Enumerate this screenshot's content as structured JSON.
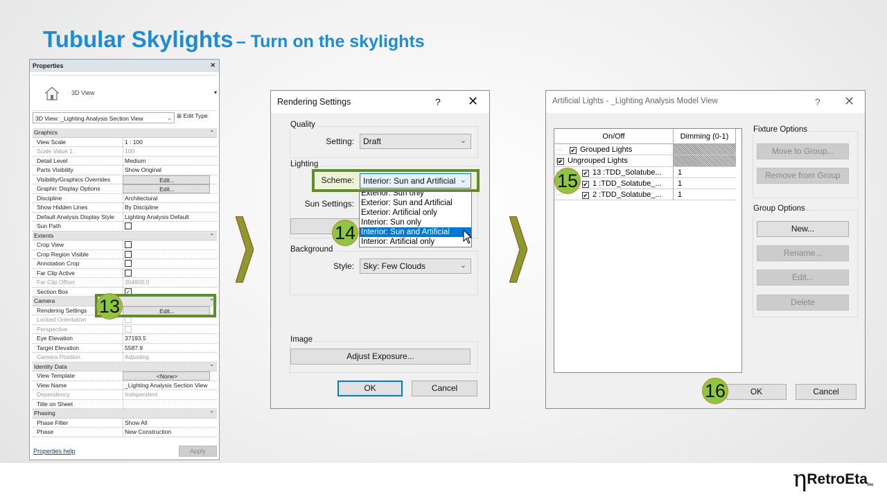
{
  "slide": {
    "title_main": "Tubular Skylights",
    "title_sub": "– Turn on the skylights",
    "logo_text": "RetroEta",
    "logo_suffix": "Inc",
    "accent": "#1e8bd3",
    "highlight_color": "#5e8d2e",
    "badge_color": "#8dc63f"
  },
  "badges": [
    "13",
    "14",
    "15",
    "16"
  ],
  "properties": {
    "title": "Properties",
    "type_label": "3D View",
    "view_selector": "3D View: _Lighting Analysis Section View",
    "edit_type": "Edit Type",
    "help_link": "Properties help",
    "apply": "Apply",
    "rows": [
      {
        "section": "Graphics"
      },
      {
        "k": "View Scale",
        "v": "1 : 100"
      },
      {
        "k": "Scale Value    1:",
        "v": "100",
        "dis": true
      },
      {
        "k": "Detail Level",
        "v": "Medium"
      },
      {
        "k": "Parts Visibility",
        "v": "Show Original"
      },
      {
        "k": "Visibility/Graphics Overrides",
        "v": "Edit...",
        "btn": true
      },
      {
        "k": "Graphic Display Options",
        "v": "Edit...",
        "btn": true
      },
      {
        "k": "Discipline",
        "v": "Architectural"
      },
      {
        "k": "Show Hidden Lines",
        "v": "By Discipline"
      },
      {
        "k": "Default Analysis Display Style",
        "v": "Lighting Analysis Default"
      },
      {
        "k": "Sun Path",
        "cb": false
      },
      {
        "section": "Extents"
      },
      {
        "k": "Crop View",
        "cb": false
      },
      {
        "k": "Crop Region Visible",
        "cb": false
      },
      {
        "k": "Annotation Crop",
        "cb": false
      },
      {
        "k": "Far Clip Active",
        "cb": false
      },
      {
        "k": "Far Clip Offset",
        "v": "304800.0",
        "dis": true
      },
      {
        "k": "Section Box",
        "cb": true
      },
      {
        "section": "Camera"
      },
      {
        "k": "Rendering Settings",
        "v": "Edit...",
        "btn": true
      },
      {
        "k": "Locked Orientation",
        "cb": false,
        "dis": true
      },
      {
        "k": "Perspective",
        "cb": false,
        "dis": true
      },
      {
        "k": "Eye Elevation",
        "v": "37193.5"
      },
      {
        "k": "Target Elevation",
        "v": "5587.9"
      },
      {
        "k": "Camera Position",
        "v": "Adjusting",
        "dis": true
      },
      {
        "section": "Identity Data"
      },
      {
        "k": "View Template",
        "v": "<None>",
        "btn": true
      },
      {
        "k": "View Name",
        "v": "_Lighting Analysis Section View"
      },
      {
        "k": "Dependency",
        "v": "Independent",
        "dis": true
      },
      {
        "k": "Title on Sheet",
        "v": ""
      },
      {
        "section": "Phasing"
      },
      {
        "k": "Phase Filter",
        "v": "Show All"
      },
      {
        "k": "Phase",
        "v": "New Construction"
      }
    ]
  },
  "rendering": {
    "title": "Rendering Settings",
    "help": "?",
    "close": "✕",
    "quality": {
      "label": "Quality",
      "setting_label": "Setting:",
      "setting_value": "Draft"
    },
    "lighting": {
      "label": "Lighting",
      "scheme_label": "Scheme:",
      "scheme_value": "Interior: Sun and Artificial",
      "sun_label": "Sun Settings:",
      "options": [
        "Exterior: Sun only",
        "Exterior: Sun and Artificial",
        "Exterior: Artificial only",
        "Interior: Sun only",
        "Interior: Sun and Artificial",
        "Interior: Artificial only"
      ],
      "selected_index": 4
    },
    "background": {
      "label": "Background",
      "style_label": "Style:",
      "style_value": "Sky: Few Clouds"
    },
    "image": {
      "label": "Image",
      "adjust": "Adjust Exposure..."
    },
    "ok": "OK",
    "cancel": "Cancel"
  },
  "artificial": {
    "title": "Artificial Lights - _Lighting Analysis Model View",
    "help": "?",
    "close": "✕",
    "columns": [
      "On/Off",
      "Dimming (0-1)"
    ],
    "rows": [
      {
        "name": "Grouped Lights",
        "checked": true,
        "dimming": "",
        "level": 0
      },
      {
        "name": "Ungrouped Lights",
        "checked": true,
        "dimming": "",
        "level": 0,
        "expander": "⊟"
      },
      {
        "name": "13 :TDD_Solatube...",
        "checked": true,
        "dimming": "1",
        "level": 1
      },
      {
        "name": "1 :TDD_Solatube_...",
        "checked": true,
        "dimming": "1",
        "level": 1
      },
      {
        "name": "2 :TDD_Solatube_...",
        "checked": true,
        "dimming": "1",
        "level": 1
      }
    ],
    "fixture_options": {
      "label": "Fixture Options",
      "buttons": [
        "Move to Group...",
        "Remove from Group"
      ]
    },
    "group_options": {
      "label": "Group Options",
      "buttons": [
        "New...",
        "Rename...",
        "Edit...",
        "Delete"
      ]
    },
    "ok": "OK",
    "cancel": "Cancel"
  }
}
